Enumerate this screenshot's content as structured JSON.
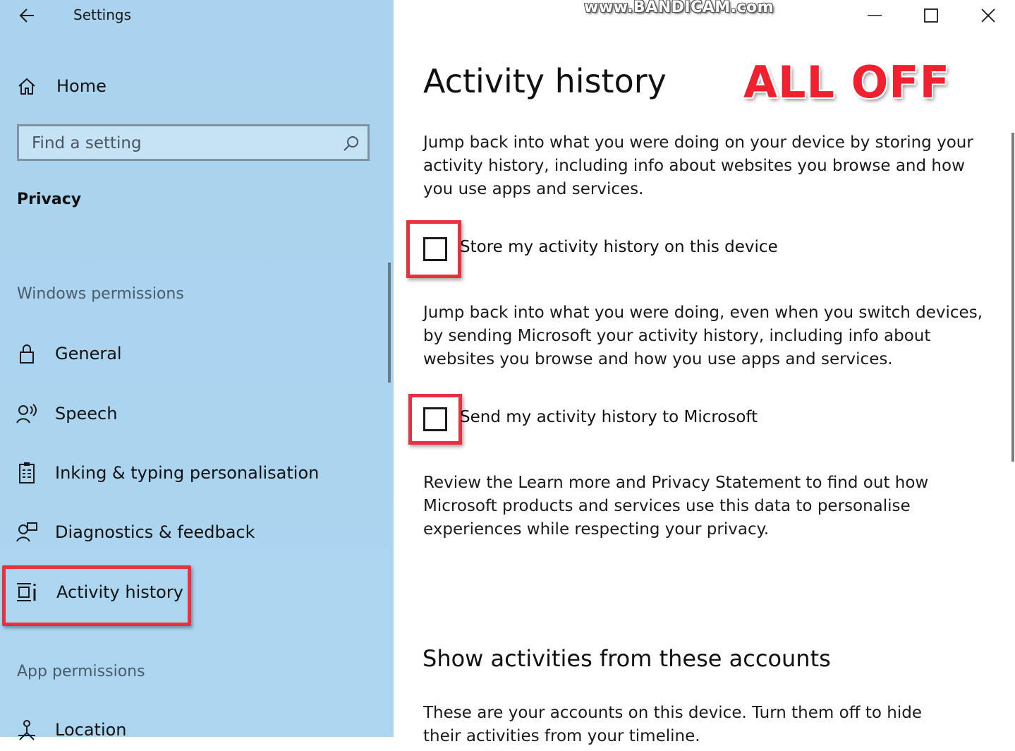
{
  "window": {
    "app_title": "Settings",
    "watermark": "www.BANDICAM.com"
  },
  "sidebar": {
    "home_label": "Home",
    "search_placeholder": "Find a setting",
    "section": "Privacy",
    "groups": {
      "windows_permissions": "Windows permissions",
      "app_permissions": "App permissions"
    },
    "items": [
      {
        "label": "General",
        "icon": "lock-icon"
      },
      {
        "label": "Speech",
        "icon": "speech-icon"
      },
      {
        "label": "Inking & typing personalisation",
        "icon": "inking-icon"
      },
      {
        "label": "Diagnostics & feedback",
        "icon": "diagnostics-icon"
      },
      {
        "label": "Activity history",
        "icon": "activity-history-icon",
        "selected": true
      },
      {
        "label": "Location",
        "icon": "location-icon"
      }
    ]
  },
  "main": {
    "title": "Activity history",
    "overlay": "ALL OFF",
    "intro": "Jump back into what you were doing on your device by storing your activity history, including info about websites you browse and how you use apps and services.",
    "store_checkbox": {
      "label": "Store my activity history on this device",
      "checked": false
    },
    "sync_text": "Jump back into what you were doing, even when you switch devices, by sending Microsoft your activity history, including info about websites you browse and how you use apps and services.",
    "send_checkbox": {
      "label": "Send my activity history to Microsoft",
      "checked": false
    },
    "review_text": "Review the Learn more and Privacy Statement to find out how Microsoft products and services use this data to personalise experiences while respecting your privacy.",
    "accounts_title": "Show activities from these accounts",
    "accounts_text": "These are your accounts on this device. Turn them off to hide their activities from your timeline."
  },
  "colors": {
    "sidebar_bg": "#a9d3ee",
    "highlight": "#e8303e"
  }
}
